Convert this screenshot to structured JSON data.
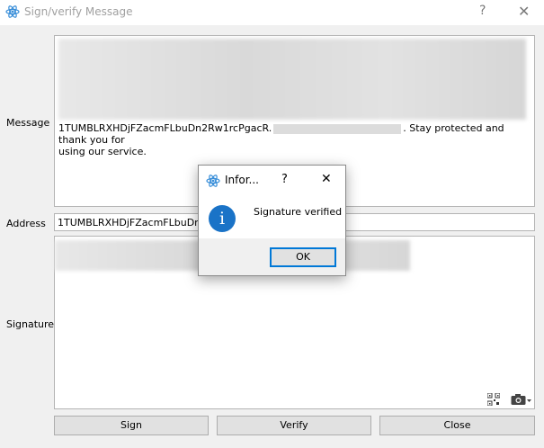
{
  "window": {
    "title": "Sign/verify Message",
    "help_glyph": "?",
    "close_glyph": "✕"
  },
  "form": {
    "message_label": "Message",
    "message_text_line1_prefix": "1TUMBLRXHDjFZacmFLbuDn2Rw1rcPgacR.",
    "message_text_line1_suffix": ". Stay protected and thank you for",
    "message_text_line2": "using our service.",
    "address_label": "Address",
    "address_value": "1TUMBLRXHDjFZacmFLbuDn2Rw",
    "signature_label": "Signature"
  },
  "buttons": {
    "sign": "Sign",
    "verify": "Verify",
    "close": "Close"
  },
  "dialog": {
    "title": "Infor...",
    "help_glyph": "?",
    "close_glyph": "✕",
    "message": "Signature verified",
    "ok": "OK",
    "icon_glyph": "i"
  },
  "icons": {
    "app": "atom-logo-icon",
    "qr": "qr-code-icon",
    "camera": "camera-icon"
  },
  "colors": {
    "info_blue": "#1a73c7",
    "focus_blue": "#0078d7"
  }
}
